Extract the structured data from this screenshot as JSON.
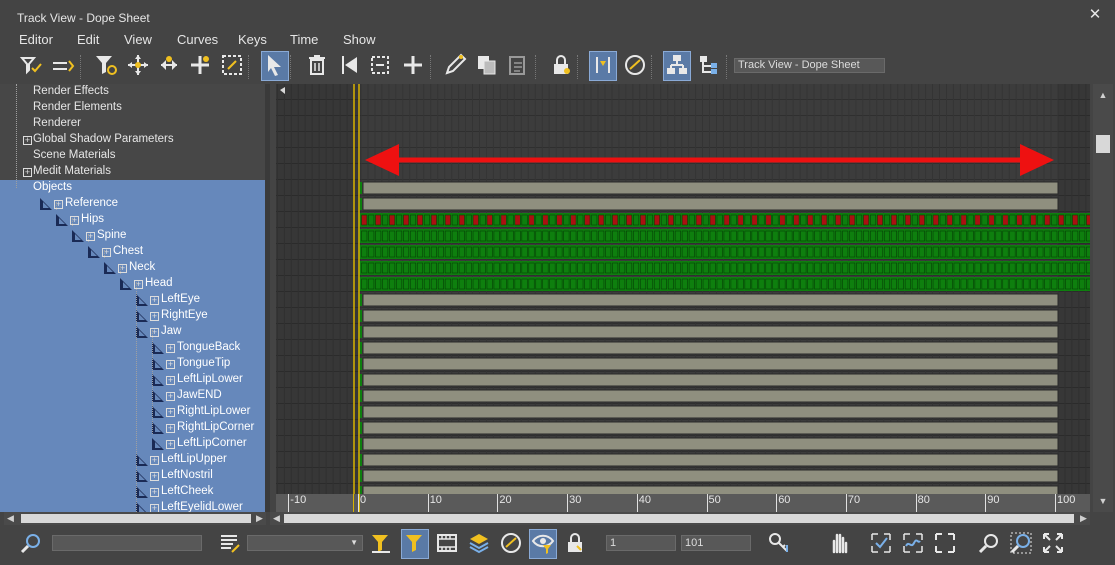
{
  "window": {
    "title": "Track View - Dope Sheet",
    "close_glyph": "✕"
  },
  "menu": [
    "Editor",
    "Edit",
    "View",
    "Curves",
    "Keys",
    "Time",
    "Show"
  ],
  "toolbar": {
    "track_view_name": "Track View - Dope Sheet",
    "buttons": [
      {
        "icon": "filter-check-icon",
        "active": false
      },
      {
        "icon": "edit-range-icon",
        "active": false
      },
      {
        "icon": "funnel-gear-icon",
        "active": false
      },
      {
        "icon": "move-keys-icon",
        "active": false
      },
      {
        "icon": "slide-keys-icon",
        "active": false
      },
      {
        "icon": "add-keys-icon",
        "active": false
      },
      {
        "icon": "scale-keys-icon",
        "active": false
      },
      {
        "icon": "select-arrow-icon",
        "active": true
      },
      {
        "icon": "delete-time-icon",
        "active": false
      },
      {
        "icon": "reverse-time-icon",
        "active": false
      },
      {
        "icon": "scale-time-icon",
        "active": false
      },
      {
        "icon": "insert-time-icon",
        "active": false
      },
      {
        "icon": "pen-icon",
        "active": false
      },
      {
        "icon": "copy-icon",
        "active": false
      },
      {
        "icon": "paste-icon",
        "active": false
      },
      {
        "icon": "lock-icon",
        "active": false
      },
      {
        "icon": "snap-frames-icon",
        "active": true
      },
      {
        "icon": "show-keyable-icon",
        "active": false
      },
      {
        "icon": "hierarchy-icon",
        "active": true
      },
      {
        "icon": "tree-layout-icon",
        "active": false
      }
    ]
  },
  "tree": {
    "items": [
      {
        "label": "Render Effects",
        "depth": 0,
        "expander": false,
        "bone": false,
        "selected": false
      },
      {
        "label": "Render Elements",
        "depth": 0,
        "expander": false,
        "bone": false,
        "selected": false
      },
      {
        "label": "Renderer",
        "depth": 0,
        "expander": false,
        "bone": false,
        "selected": false
      },
      {
        "label": "Global Shadow Parameters",
        "depth": 0,
        "expander": true,
        "bone": false,
        "selected": false
      },
      {
        "label": "Scene Materials",
        "depth": 0,
        "expander": false,
        "bone": false,
        "selected": false
      },
      {
        "label": "Medit Materials",
        "depth": 0,
        "expander": true,
        "bone": false,
        "selected": false
      },
      {
        "label": "Objects",
        "depth": 0,
        "expander": false,
        "bone": false,
        "selected": true
      },
      {
        "label": "Reference",
        "depth": 1,
        "expander": true,
        "bone": true,
        "selected": true
      },
      {
        "label": "Hips",
        "depth": 2,
        "expander": true,
        "bone": true,
        "selected": true
      },
      {
        "label": "Spine",
        "depth": 3,
        "expander": true,
        "bone": true,
        "selected": true
      },
      {
        "label": "Chest",
        "depth": 4,
        "expander": true,
        "bone": true,
        "selected": true
      },
      {
        "label": "Neck",
        "depth": 5,
        "expander": true,
        "bone": true,
        "selected": true
      },
      {
        "label": "Head",
        "depth": 6,
        "expander": true,
        "bone": true,
        "selected": true
      },
      {
        "label": "LeftEye",
        "depth": 7,
        "expander": true,
        "bone": true,
        "selected": true
      },
      {
        "label": "RightEye",
        "depth": 7,
        "expander": true,
        "bone": true,
        "selected": true
      },
      {
        "label": "Jaw",
        "depth": 7,
        "expander": true,
        "bone": true,
        "selected": true
      },
      {
        "label": "TongueBack",
        "depth": 8,
        "expander": true,
        "bone": true,
        "selected": true
      },
      {
        "label": "TongueTip",
        "depth": 8,
        "expander": true,
        "bone": true,
        "selected": true
      },
      {
        "label": "LeftLipLower",
        "depth": 8,
        "expander": true,
        "bone": true,
        "selected": true
      },
      {
        "label": "JawEND",
        "depth": 8,
        "expander": true,
        "bone": true,
        "selected": true
      },
      {
        "label": "RightLipLower",
        "depth": 8,
        "expander": true,
        "bone": true,
        "selected": true
      },
      {
        "label": "RightLipCorner",
        "depth": 8,
        "expander": true,
        "bone": true,
        "selected": true
      },
      {
        "label": "LeftLipCorner",
        "depth": 8,
        "expander": true,
        "bone": true,
        "selected": true
      },
      {
        "label": "LeftLipUpper",
        "depth": 7,
        "expander": true,
        "bone": true,
        "selected": true
      },
      {
        "label": "LeftNostril",
        "depth": 7,
        "expander": true,
        "bone": true,
        "selected": true
      },
      {
        "label": "LeftCheek",
        "depth": 7,
        "expander": true,
        "bone": true,
        "selected": true
      },
      {
        "label": "LeftEyelidLower",
        "depth": 7,
        "expander": true,
        "bone": true,
        "selected": true
      }
    ]
  },
  "dope_sheet": {
    "frame_range": [
      0,
      100
    ],
    "current_frame": 0,
    "ruler_ticks": [
      "-10",
      "0",
      "10",
      "20",
      "30",
      "40",
      "50",
      "60",
      "70",
      "80",
      "90",
      "100"
    ],
    "colors": {
      "range_bar": "#8f8f7f",
      "key_red": "#aa1111",
      "key_green": "#0e7f0e",
      "time_slider": "#d8b400",
      "annotation_arrow": "#ee1111"
    }
  },
  "bottombar": {
    "start_frame": "1",
    "end_frame": "101",
    "search_placeholder": "",
    "buttons": [
      {
        "icon": "zoom-search-icon",
        "active": false
      },
      {
        "icon": "list-filter-icon",
        "active": false
      },
      {
        "icon": "filter-down-icon",
        "active": false
      },
      {
        "icon": "filter-active-icon",
        "active": true
      },
      {
        "icon": "film-icon",
        "active": false
      },
      {
        "icon": "layers-icon",
        "active": false
      },
      {
        "icon": "show-keyable-bottom-icon",
        "active": false
      },
      {
        "icon": "eye-filter-icon",
        "active": true
      },
      {
        "icon": "lock-selection-icon",
        "active": false
      },
      {
        "icon": "key-info-icon",
        "active": false
      },
      {
        "icon": "pan-hand-icon",
        "active": false
      },
      {
        "icon": "zoom-extents-icon",
        "active": false
      },
      {
        "icon": "zoom-value-icon",
        "active": false
      },
      {
        "icon": "frame-icon",
        "active": false
      },
      {
        "icon": "zoom-icon",
        "active": false
      },
      {
        "icon": "zoom-region-icon",
        "active": false
      },
      {
        "icon": "fit-icon",
        "active": false
      }
    ]
  }
}
